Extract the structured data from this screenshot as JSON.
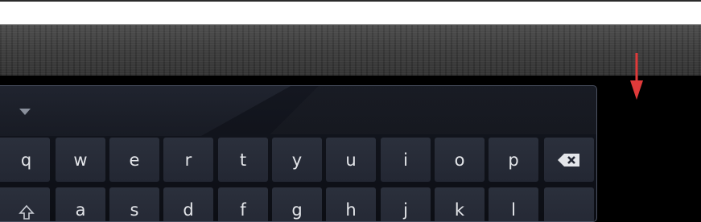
{
  "top_field": {
    "value": ""
  },
  "keyboard": {
    "row1": [
      "q",
      "w",
      "e",
      "r",
      "t",
      "y",
      "u",
      "i",
      "o",
      "p"
    ],
    "row2": [
      "a",
      "s",
      "d",
      "f",
      "g",
      "h",
      "j",
      "k",
      "l"
    ],
    "backspace_icon": "backspace-icon",
    "shift_icon": "shift-icon",
    "collapse_icon": "collapse-keyboard-icon"
  },
  "colors": {
    "key_bg": "#272b37",
    "key_text": "#e4e6ea",
    "arrow": "#e03a3a"
  }
}
